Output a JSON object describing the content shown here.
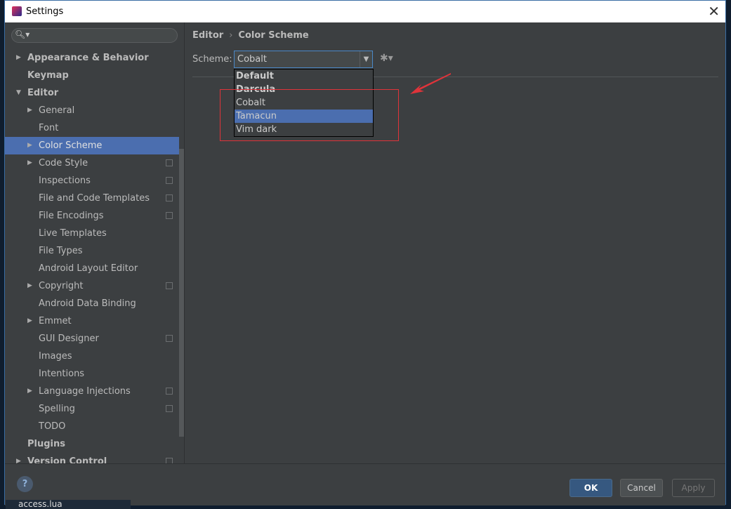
{
  "window": {
    "title": "Settings"
  },
  "sidebar": {
    "search_placeholder": "",
    "items": [
      {
        "label": "Appearance & Behavior",
        "level": 0,
        "arrow": "right",
        "bold": true
      },
      {
        "label": "Keymap",
        "level": 0,
        "bold": true
      },
      {
        "label": "Editor",
        "level": 0,
        "arrow": "down",
        "bold": true
      },
      {
        "label": "General",
        "level": 1,
        "arrow": "right"
      },
      {
        "label": "Font",
        "level": 1
      },
      {
        "label": "Color Scheme",
        "level": 1,
        "arrow": "right",
        "selected": true
      },
      {
        "label": "Code Style",
        "level": 1,
        "arrow": "right",
        "copy": true
      },
      {
        "label": "Inspections",
        "level": 1,
        "copy": true
      },
      {
        "label": "File and Code Templates",
        "level": 1,
        "copy": true
      },
      {
        "label": "File Encodings",
        "level": 1,
        "copy": true
      },
      {
        "label": "Live Templates",
        "level": 1
      },
      {
        "label": "File Types",
        "level": 1
      },
      {
        "label": "Android Layout Editor",
        "level": 1
      },
      {
        "label": "Copyright",
        "level": 1,
        "arrow": "right",
        "copy": true
      },
      {
        "label": "Android Data Binding",
        "level": 1
      },
      {
        "label": "Emmet",
        "level": 1,
        "arrow": "right"
      },
      {
        "label": "GUI Designer",
        "level": 1,
        "copy": true
      },
      {
        "label": "Images",
        "level": 1
      },
      {
        "label": "Intentions",
        "level": 1
      },
      {
        "label": "Language Injections",
        "level": 1,
        "arrow": "right",
        "copy": true
      },
      {
        "label": "Spelling",
        "level": 1,
        "copy": true
      },
      {
        "label": "TODO",
        "level": 1
      },
      {
        "label": "Plugins",
        "level": 0,
        "bold": true
      },
      {
        "label": "Version Control",
        "level": 0,
        "arrow": "right",
        "bold": true,
        "copy": true
      }
    ]
  },
  "content": {
    "breadcrumb": [
      "Editor",
      "Color Scheme"
    ],
    "breadcrumb_sep": "›",
    "scheme_label": "Scheme:",
    "scheme_value": "Cobalt",
    "options": [
      {
        "label": "Default",
        "bold": true
      },
      {
        "label": "Darcula",
        "bold": true
      },
      {
        "label": "Cobalt"
      },
      {
        "label": "Tamacun",
        "highlighted": true
      },
      {
        "label": "Vim dark"
      }
    ]
  },
  "footer": {
    "help": "?",
    "ok": "OK",
    "cancel": "Cancel",
    "apply": "Apply"
  },
  "taskbar": {
    "file": "access.lua"
  },
  "colors": {
    "selection": "#4b6eaf",
    "annotation": "#e0333a"
  }
}
